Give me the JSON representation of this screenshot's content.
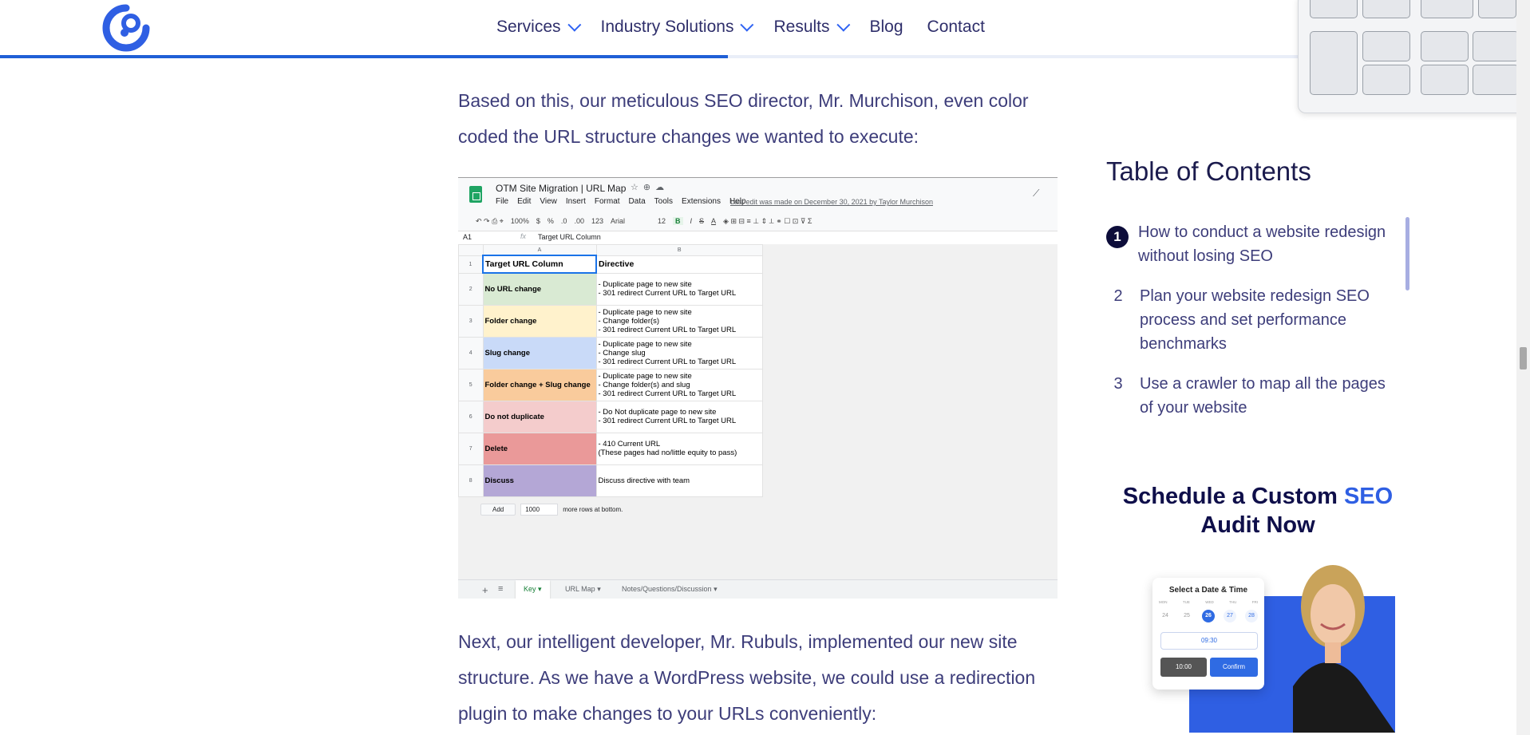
{
  "nav": {
    "items": [
      {
        "label": "Services",
        "has_dropdown": true
      },
      {
        "label": "Industry Solutions",
        "has_dropdown": true
      },
      {
        "label": "Results",
        "has_dropdown": true
      },
      {
        "label": "Blog",
        "has_dropdown": false
      },
      {
        "label": "Contact",
        "has_dropdown": false
      }
    ]
  },
  "reading_progress": 0.48,
  "article": {
    "paragraph_1": "Based on this, our meticulous SEO director, Mr. Murchison, even color coded the URL structure changes we wanted to execute:",
    "paragraph_2": "Next, our intelligent developer, Mr. Rubuls, implemented our new site structure. As we have a WordPress website, we could use a redirection plugin to make changes to your URLs conveniently:"
  },
  "spreadsheet": {
    "title": "OTM Site Migration | URL Map",
    "menus": [
      "File",
      "Edit",
      "View",
      "Insert",
      "Format",
      "Data",
      "Tools",
      "Extensions",
      "Help"
    ],
    "last_edit": "Last edit was made on December 30, 2021 by Taylor Murchison",
    "toolbar": {
      "zoom": "100%",
      "currency": "$",
      "percent": "%",
      "dec1": ".0",
      "dec2": ".00",
      "format": "123",
      "font": "Arial",
      "size": "12",
      "bold": "B",
      "italic": "I",
      "strike": "S",
      "color": "A"
    },
    "cell_ref": "A1",
    "fx": "fx",
    "formula_value": "Target URL Column",
    "col_a": "A",
    "col_b": "B",
    "header_row": {
      "num": "1",
      "a": "Target URL Column",
      "b": "Directive"
    },
    "rows": [
      {
        "num": "2",
        "a": "No URL change",
        "color": "#d9ead3",
        "b": [
          "- Duplicate page to new site",
          "- 301 redirect Current URL to Target URL"
        ]
      },
      {
        "num": "3",
        "a": "Folder change",
        "color": "#fff2cc",
        "b": [
          "- Duplicate page to new site",
          "- Change folder(s)",
          "- 301 redirect Current URL to Target URL"
        ]
      },
      {
        "num": "4",
        "a": "Slug change",
        "color": "#c9daf8",
        "b": [
          "- Duplicate page to new site",
          "- Change slug",
          "- 301 redirect Current URL to Target URL"
        ]
      },
      {
        "num": "5",
        "a": "Folder change + Slug change",
        "color": "#f9cb9c",
        "b": [
          "- Duplicate page to new site",
          "- Change folder(s) and slug",
          "- 301 redirect Current URL to Target URL"
        ]
      },
      {
        "num": "6",
        "a": "Do not duplicate",
        "color": "#f4cccc",
        "b": [
          "- Do Not duplicate page to new site",
          "- 301 redirect Current URL to Target URL"
        ]
      },
      {
        "num": "7",
        "a": "Delete",
        "color": "#ea9999",
        "b": [
          "- 410 Current URL",
          "(These pages had no/little equity to pass)"
        ]
      },
      {
        "num": "8",
        "a": "Discuss",
        "color": "#b4a7d6",
        "b": [
          "Discuss directive with team"
        ]
      }
    ],
    "add_label": "Add",
    "add_value": "1000",
    "add_suffix": "more rows at bottom.",
    "tabs": [
      {
        "label": "Key",
        "active": true
      },
      {
        "label": "URL Map",
        "active": false
      },
      {
        "label": "Notes/Questions/Discussion",
        "active": false
      }
    ]
  },
  "toc": {
    "title": "Table of Contents",
    "items": [
      {
        "num": "1",
        "text": "How to conduct a website redesign without losing SEO",
        "active": true
      },
      {
        "num": "2",
        "text": "Plan your website redesign SEO process and set performance benchmarks",
        "active": false
      },
      {
        "num": "3",
        "text": "Use a crawler to map all the pages of your website",
        "active": false
      }
    ]
  },
  "cta": {
    "title_part1": "Schedule a Custom ",
    "title_highlight": "SEO",
    "title_part2": "Audit Now",
    "calendar": {
      "title": "Select a Date & Time",
      "days": [
        "MON",
        "TUE",
        "WED",
        "THU",
        "FRI"
      ],
      "dates": [
        "24",
        "25",
        "26",
        "27",
        "28"
      ],
      "selected_date": "26",
      "time_value": "09:30",
      "button_time": "10:00",
      "button_confirm": "Confirm"
    }
  },
  "colors": {
    "brand_blue": "#2f5fe3",
    "navy": "#0f0f4a",
    "text": "#3d3d7a"
  }
}
